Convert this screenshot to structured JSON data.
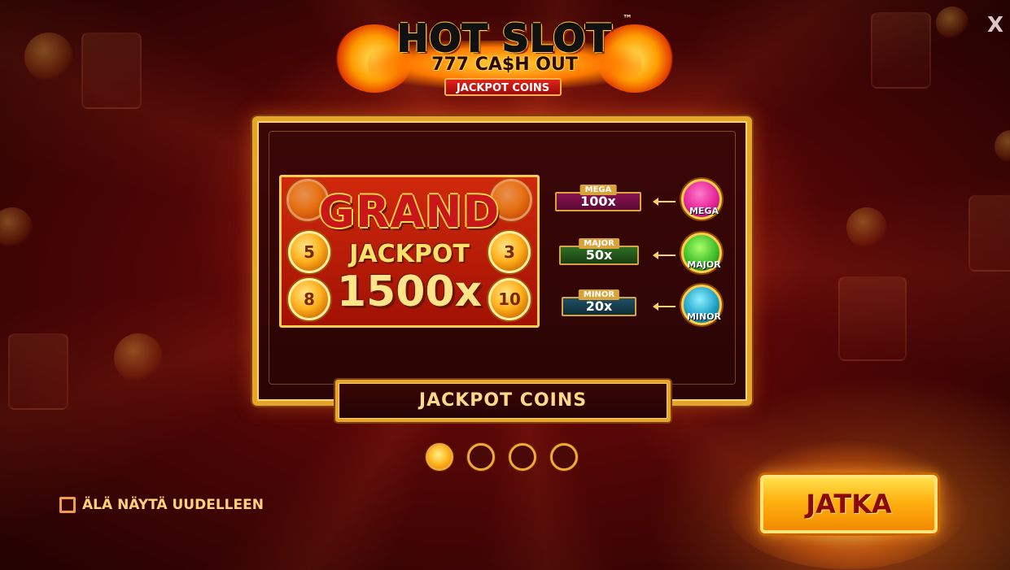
{
  "close": {
    "label": "X"
  },
  "logo": {
    "title": "HOT SLOT",
    "trademark": "™",
    "subtitle": "777 CA$H OUT",
    "badge": "JACKPOT COINS"
  },
  "illustration": {
    "grand_word": "GRAND",
    "jackpot_word": "JACKPOT",
    "multiplier": "1500x",
    "coins": [
      "5",
      "3",
      "8",
      "10"
    ]
  },
  "jackpots": [
    {
      "name": "MEGA",
      "value": "100x",
      "coin_label": "MEGA",
      "color": "#c0186e",
      "coin_color": "#e4259a"
    },
    {
      "name": "MAJOR",
      "value": "50x",
      "coin_label": "MAJOR",
      "color": "#235d1e",
      "coin_color": "#3fbf2a"
    },
    {
      "name": "MINOR",
      "value": "20x",
      "coin_label": "MINOR",
      "color": "#17414f",
      "coin_color": "#1fa3c8"
    }
  ],
  "banner": {
    "label": "JACKPOT COINS"
  },
  "pager": {
    "count": 4,
    "active_index": 0
  },
  "dont_show": {
    "label": "ÄLÄ NÄYTÄ UUDELLEEN",
    "checked": false
  },
  "continue_button": {
    "label": "JATKA"
  }
}
